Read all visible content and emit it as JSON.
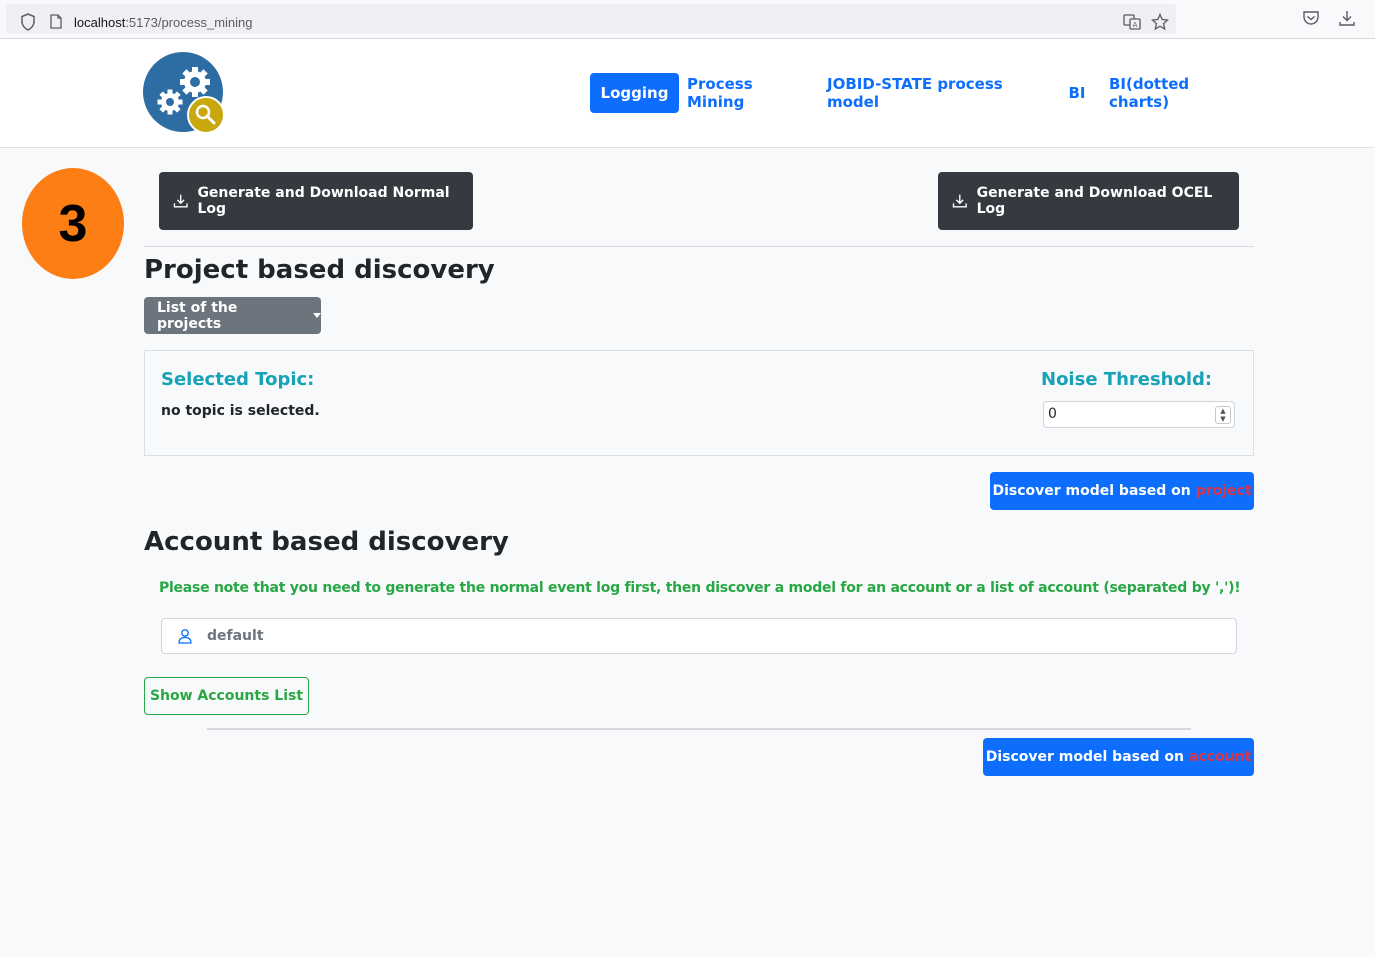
{
  "browser": {
    "url_host": "localhost",
    "url_path": ":5173/process_mining"
  },
  "nav": {
    "items": [
      {
        "label": "Logging",
        "active": true
      },
      {
        "label": "Process Mining"
      },
      {
        "label": "JOBID-STATE process model"
      },
      {
        "label": "BI"
      },
      {
        "label": "BI(dotted charts)"
      }
    ]
  },
  "step_badge": "3",
  "log_buttons": {
    "normal": "Generate and Download Normal Log",
    "ocel": "Generate and Download OCEL Log"
  },
  "project_section": {
    "title": "Project based discovery",
    "dropdown_label": "List of the projects",
    "selected_topic_label": "Selected Topic:",
    "selected_topic_value": "no topic is selected.",
    "noise_label": "Noise Threshold:",
    "noise_value": "0",
    "discover_prefix": "Discover model based on",
    "discover_highlight": "project"
  },
  "account_section": {
    "title": "Account based discovery",
    "note": "Please note that you need to generate the normal event log first, then discover a model for an account or a list of account (separated by ',')!",
    "input_value": "default",
    "show_accounts_label": "Show Accounts List",
    "discover_prefix": "Discover model based on",
    "discover_highlight": "account"
  },
  "colors": {
    "primary": "#0d6efd",
    "dark": "#343a40",
    "secondary": "#6c757d",
    "teal": "#17a2b8",
    "success": "#28a745",
    "danger": "#dc3545",
    "badge": "#fd7e14"
  }
}
